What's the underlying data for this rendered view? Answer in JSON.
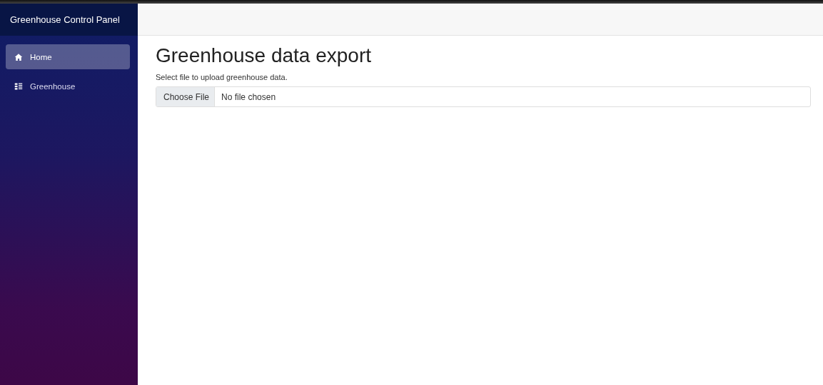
{
  "sidebar": {
    "title": "Greenhouse Control Panel",
    "items": [
      {
        "label": "Home",
        "kind": "home",
        "selected": true
      },
      {
        "label": "Greenhouse",
        "kind": "list",
        "selected": false
      }
    ]
  },
  "page": {
    "heading": "Greenhouse data export",
    "instruction": "Select file to upload greenhouse data.",
    "file_input": {
      "button": "Choose File",
      "status": "No file chosen"
    }
  }
}
